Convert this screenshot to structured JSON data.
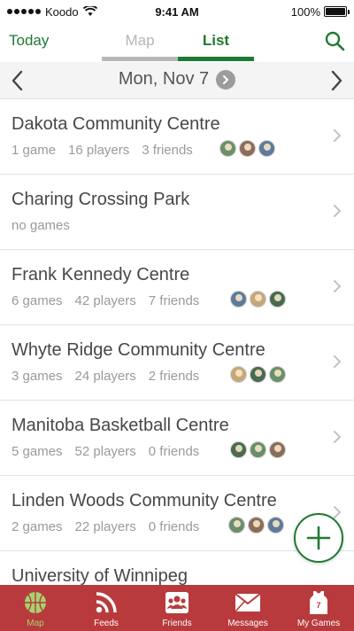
{
  "status_bar": {
    "carrier": "Koodo",
    "time": "9:41 AM",
    "battery": "100%",
    "battery_level": 1.0
  },
  "nav": {
    "today": "Today",
    "tabs": [
      {
        "label": "Map",
        "active": false
      },
      {
        "label": "List",
        "active": true
      }
    ]
  },
  "date_bar": {
    "date": "Mon, Nov 7"
  },
  "venues": [
    {
      "name": "Dakota Community Centre",
      "games": "1 game",
      "players": "16 players",
      "friends": "3 friends",
      "friend_count": 3
    },
    {
      "name": "Charing Crossing Park",
      "games": "no games",
      "players": "",
      "friends": "",
      "friend_count": 0
    },
    {
      "name": "Frank Kennedy Centre",
      "games": "6 games",
      "players": "42 players",
      "friends": "7 friends",
      "friend_count": 3
    },
    {
      "name": "Whyte Ridge Community Centre",
      "games": "3 games",
      "players": "24 players",
      "friends": "2 friends",
      "friend_count": 3
    },
    {
      "name": "Manitoba Basketball Centre",
      "games": "5 games",
      "players": "52 players",
      "friends": "0 friends",
      "friend_count": 3
    },
    {
      "name": "Linden Woods Community Centre",
      "games": "2 games",
      "players": "22 players",
      "friends": "0 friends",
      "friend_count": 3
    },
    {
      "name": "University of Winnipeg",
      "games": "",
      "players": "",
      "friends": "",
      "friend_count": 0
    }
  ],
  "tab_bar": {
    "items": [
      {
        "label": "Map",
        "icon": "basketball-icon",
        "active": true
      },
      {
        "label": "Feeds",
        "icon": "rss-feed-icon",
        "active": false
      },
      {
        "label": "Friends",
        "icon": "friends-icon",
        "active": false
      },
      {
        "label": "Messages",
        "icon": "envelope-icon",
        "active": false
      },
      {
        "label": "My Games",
        "icon": "jersey-icon",
        "active": false
      }
    ]
  },
  "colors": {
    "accent_green": "#1f7a33",
    "tab_bar_red": "#b93a3d",
    "active_tab_green": "#a5d36f"
  }
}
